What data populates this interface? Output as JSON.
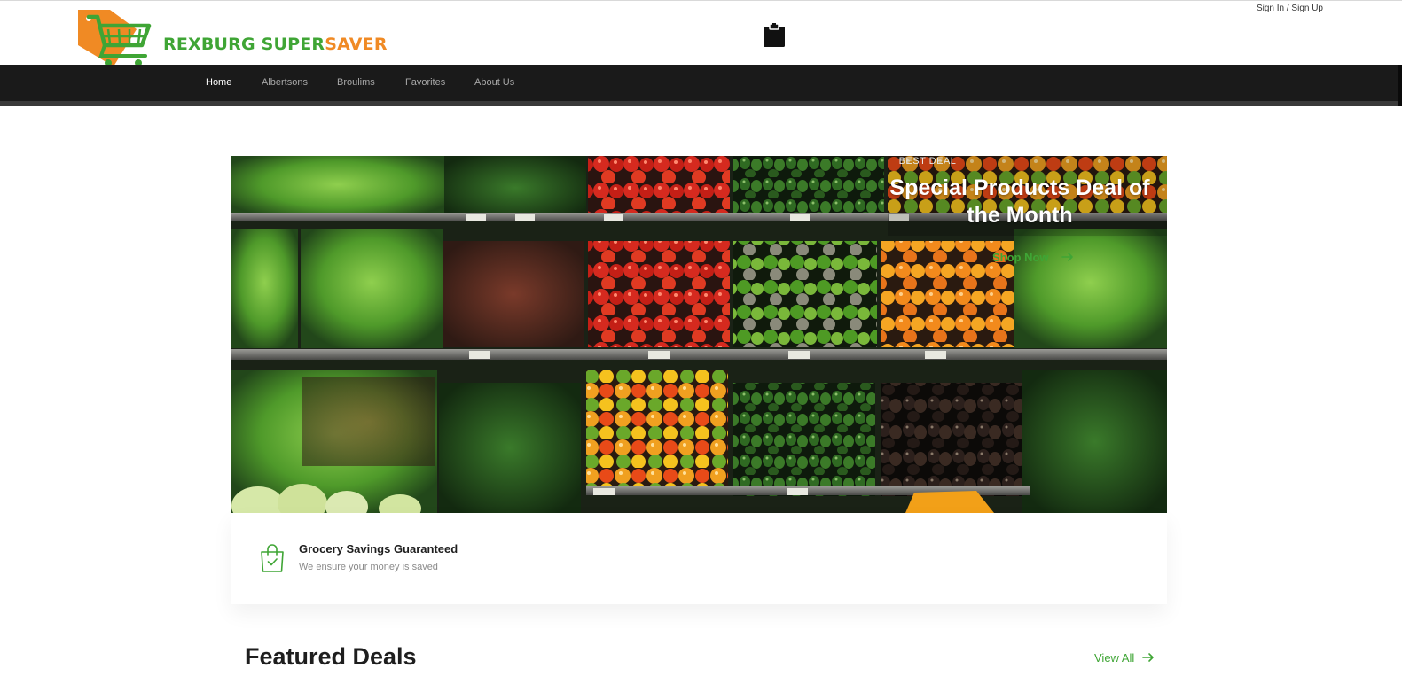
{
  "header": {
    "brand": {
      "part1": "REXBURG SUPER",
      "part2": "SAVER"
    },
    "cart_icon": "shopping-cart-icon",
    "clipboard_icon": "clipboard-icon",
    "auth_link": "Sign In / Sign Up"
  },
  "nav": {
    "items": [
      {
        "label": "Home",
        "active": true
      },
      {
        "label": "Albertsons",
        "active": false
      },
      {
        "label": "Broulims",
        "active": false
      },
      {
        "label": "Favorites",
        "active": false
      },
      {
        "label": "About Us",
        "active": false
      }
    ]
  },
  "hero": {
    "overline": "BEST DEAL",
    "title": "Special Products Deal of the Month",
    "cta_label": "Shop Now",
    "cta_icon": "arrow-right-icon"
  },
  "feature": {
    "icon": "shopping-bag-check-icon",
    "title": "Grocery Savings Guaranteed",
    "subtitle": "We ensure your money is saved"
  },
  "featured": {
    "title": "Featured Deals",
    "view_all_label": "View All",
    "view_all_icon": "arrow-right-icon"
  },
  "colors": {
    "brand_green": "#3fa535",
    "brand_orange": "#f08a24",
    "nav_bg": "#1a1a1a"
  }
}
